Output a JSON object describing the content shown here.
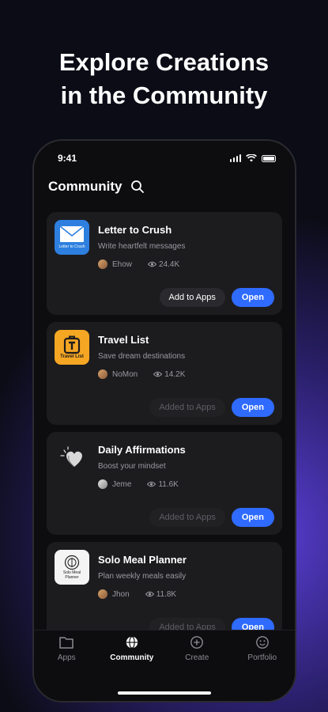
{
  "headline": {
    "line1": "Explore Creations",
    "line2": "in the Community"
  },
  "status_bar": {
    "time": "9:41"
  },
  "header": {
    "title": "Community",
    "search_icon": "search-icon"
  },
  "apps": [
    {
      "title": "Letter to Crush",
      "desc": "Write heartfelt messages",
      "author": "Ehow",
      "views": "24.4K",
      "icon_label": "Letter to Crush",
      "add_label": "Add to Apps",
      "add_state": "not-added",
      "open_label": "Open"
    },
    {
      "title": "Travel List",
      "desc": "Save dream destinations",
      "author": "NoMon",
      "views": "14.2K",
      "icon_label": "Travel List",
      "add_label": "Added to Apps",
      "add_state": "added",
      "open_label": "Open"
    },
    {
      "title": "Daily Affirmations",
      "desc": "Boost your mindset",
      "author": "Jeme",
      "views": "11.6K",
      "icon_label": "",
      "add_label": "Added to Apps",
      "add_state": "added",
      "open_label": "Open"
    },
    {
      "title": "Solo Meal Planner",
      "desc": "Plan weekly meals easily",
      "author": "Jhon",
      "views": "11.8K",
      "icon_label": "Solo Meal Planner",
      "add_label": "Added to Apps",
      "add_state": "added",
      "open_label": "Open"
    }
  ],
  "tabbar": {
    "tabs": [
      {
        "label": "Apps",
        "icon": "folder-icon",
        "active": false
      },
      {
        "label": "Community",
        "icon": "globe-icon",
        "active": true
      },
      {
        "label": "Create",
        "icon": "add-icon",
        "active": false
      },
      {
        "label": "Portfolio",
        "icon": "smiley-icon",
        "active": false
      }
    ]
  },
  "colors": {
    "accent": "#2f6bff",
    "card": "#1c1c1f",
    "background": "#0d0d0f"
  }
}
